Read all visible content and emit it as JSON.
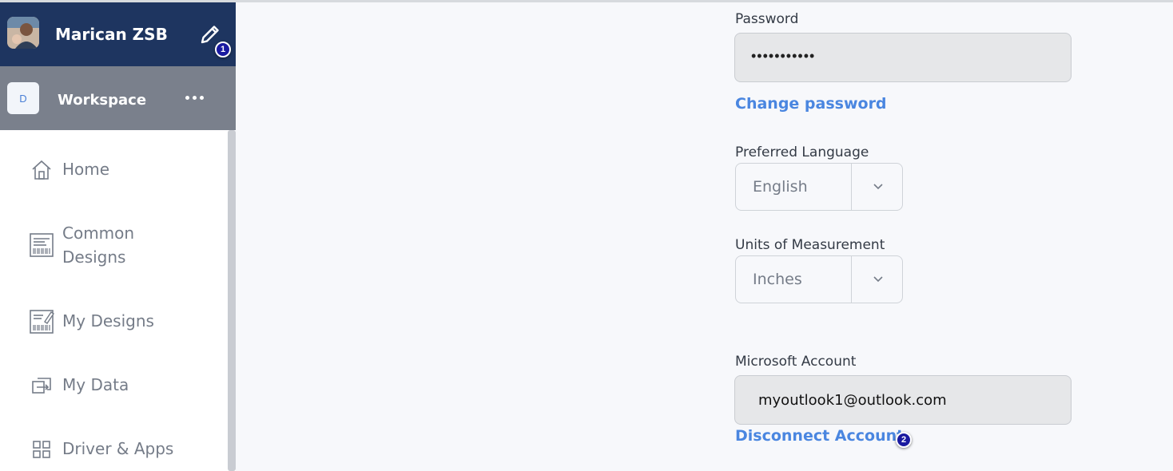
{
  "user": {
    "name": "Marican ZSB"
  },
  "workspace": {
    "initial": "D",
    "name": "Workspace"
  },
  "nav": {
    "items": [
      {
        "label": "Home",
        "icon": "home-icon"
      },
      {
        "label": "Common\nDesigns",
        "icon": "barcode-label-icon"
      },
      {
        "label": "My Designs",
        "icon": "edit-label-icon"
      },
      {
        "label": "My Data",
        "icon": "data-link-icon"
      },
      {
        "label": "Driver & Apps",
        "icon": "grid-icon"
      }
    ]
  },
  "form": {
    "password": {
      "label": "Password",
      "value": "•••••••••••"
    },
    "change_password": "Change password",
    "language": {
      "label": "Preferred Language",
      "value": "English"
    },
    "units": {
      "label": "Units of Measurement",
      "value": "Inches"
    },
    "microsoft": {
      "label": "Microsoft Account",
      "value": "myoutlook1@outlook.com"
    },
    "disconnect": "Disconnect Account"
  },
  "annotations": {
    "badge1": "1",
    "badge2": "2"
  },
  "colors": {
    "user_bar": "#1e3560",
    "workspace_bar": "#7a808c",
    "link": "#4a86e0",
    "badge": "#1a1aa0"
  }
}
